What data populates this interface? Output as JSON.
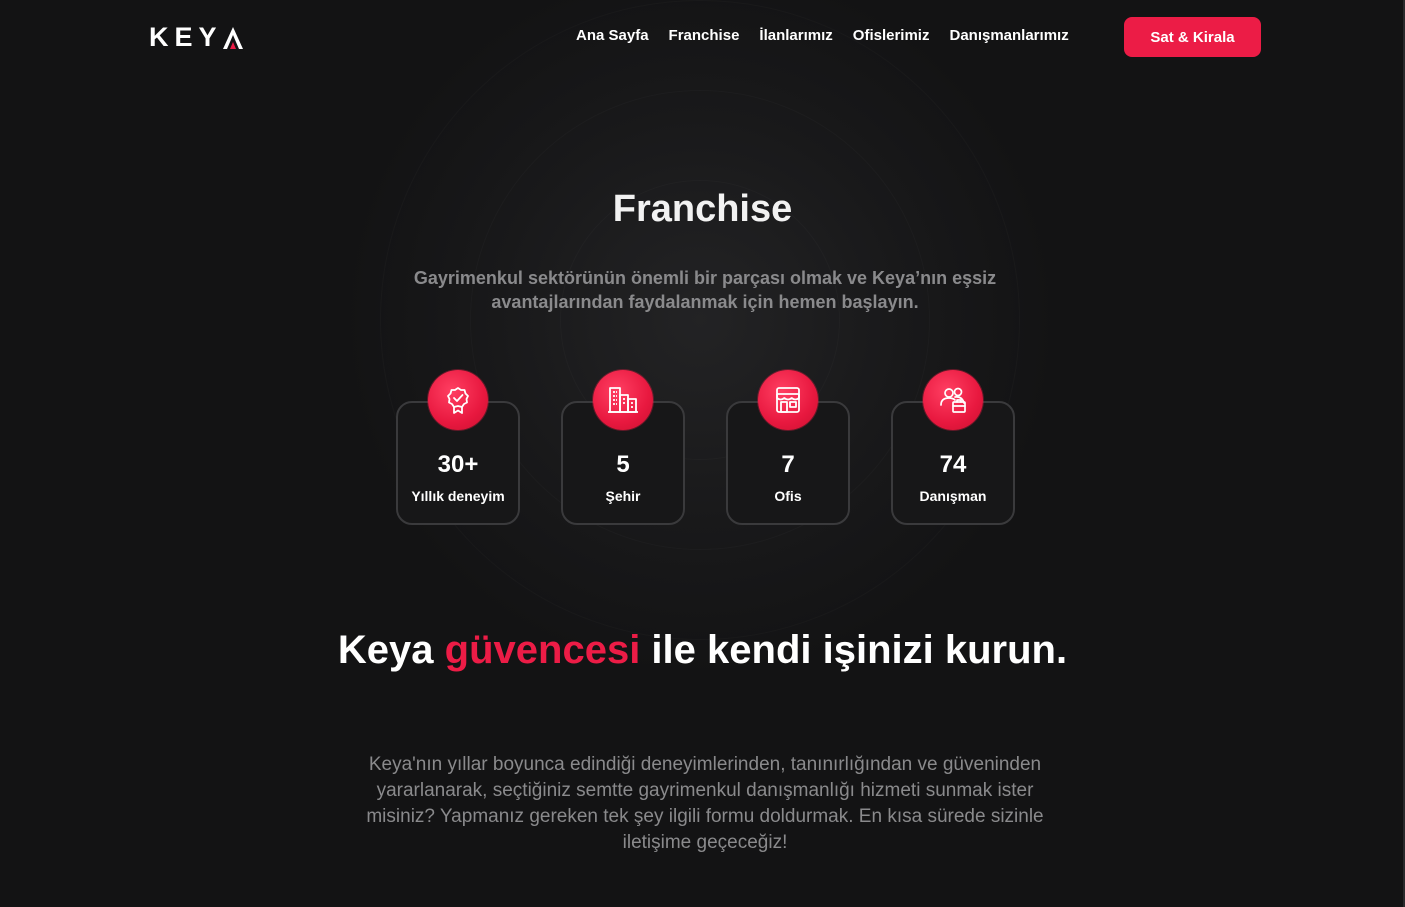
{
  "brand": {
    "logo_text": "KEY",
    "logo_last_letter": "Λ",
    "accent_color": "#ec1c46"
  },
  "nav": {
    "items": [
      {
        "label": "Ana Sayfa"
      },
      {
        "label": "Franchise"
      },
      {
        "label": "İlanlarımız"
      },
      {
        "label": "Ofislerimiz"
      },
      {
        "label": "Danışmanlarımız"
      }
    ],
    "cta_label": "Sat & Kirala"
  },
  "hero": {
    "title": "Franchise",
    "subtitle": "Gayrimenkul sektörünün önemli bir parçası olmak ve Keya’nın eşsiz avantajlarından faydalanmak için hemen başlayın."
  },
  "stats": [
    {
      "icon": "award-badge-icon",
      "value": "30+",
      "label": "Yıllık deneyim"
    },
    {
      "icon": "buildings-icon",
      "value": "5",
      "label": "Şehir"
    },
    {
      "icon": "storefront-icon",
      "value": "7",
      "label": "Ofis"
    },
    {
      "icon": "advisors-icon",
      "value": "74",
      "label": "Danışman"
    }
  ],
  "section": {
    "title_part1": "Keya ",
    "title_accent": "güvencesi",
    "title_part2": " ile kendi işinizi kurun.",
    "body": "Keya'nın yıllar boyunca edindiği deneyimlerinden, tanınırlığından ve güveninden yararlanarak, seçtiğiniz semtte gayrimenkul danışmanlığı hizmeti sunmak ister misiniz? Yapmanız gereken tek şey ilgili formu doldurmak. En kısa sürede sizinle iletişime geçeceğiz!"
  }
}
